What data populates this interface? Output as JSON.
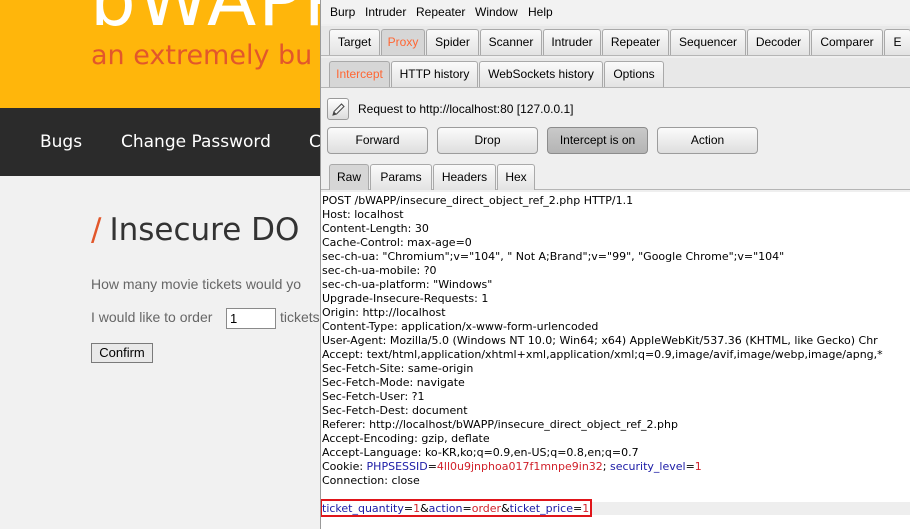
{
  "bwapp": {
    "logo": "bWAPP",
    "tagline": "an extremely bu",
    "nav": [
      "Bugs",
      "Change Password",
      "C"
    ],
    "title": "Insecure DO",
    "question": "How many movie tickets would yo",
    "order_label": "I would like to order",
    "quantity": "1",
    "tickets_label": "tickets",
    "confirm": "Confirm"
  },
  "burp": {
    "menu": [
      "Burp",
      "Intruder",
      "Repeater",
      "Window",
      "Help"
    ],
    "tabs": [
      "Target",
      "Proxy",
      "Spider",
      "Scanner",
      "Intruder",
      "Repeater",
      "Sequencer",
      "Decoder",
      "Comparer",
      "E"
    ],
    "subtabs": [
      "Intercept",
      "HTTP history",
      "WebSockets history",
      "Options"
    ],
    "request_to": "Request to http://localhost:80  [127.0.0.1]",
    "buttons": {
      "forward": "Forward",
      "drop": "Drop",
      "intercept": "Intercept is on",
      "action": "Action"
    },
    "viewtabs": [
      "Raw",
      "Params",
      "Headers",
      "Hex"
    ],
    "request_lines": [
      "POST /bWAPP/insecure_direct_object_ref_2.php HTTP/1.1",
      "Host: localhost",
      "Content-Length: 30",
      "Cache-Control: max-age=0",
      "sec-ch-ua: \"Chromium\";v=\"104\", \" Not A;Brand\";v=\"99\", \"Google Chrome\";v=\"104\"",
      "sec-ch-ua-mobile: ?0",
      "sec-ch-ua-platform: \"Windows\"",
      "Upgrade-Insecure-Requests: 1",
      "Origin: http://localhost",
      "Content-Type: application/x-www-form-urlencoded",
      "User-Agent: Mozilla/5.0 (Windows NT 10.0; Win64; x64) AppleWebKit/537.36 (KHTML, like Gecko) Chr",
      "Accept: text/html,application/xhtml+xml,application/xml;q=0.9,image/avif,image/webp,image/apng,*",
      "Sec-Fetch-Site: same-origin",
      "Sec-Fetch-Mode: navigate",
      "Sec-Fetch-User: ?1",
      "Sec-Fetch-Dest: document",
      "Referer: http://localhost/bWAPP/insecure_direct_object_ref_2.php",
      "Accept-Encoding: gzip, deflate",
      "Accept-Language: ko-KR,ko;q=0.9,en-US;q=0.8,en;q=0.7"
    ],
    "cookie": {
      "label": "Cookie: ",
      "name1": "PHPSESSID",
      "eq": "=",
      "value1": "4ll0u9jnphoa017f1mnpe9in32",
      "sep": "; ",
      "name2": "security_level",
      "value2": "1"
    },
    "connection": "Connection: close",
    "body": {
      "p1": "ticket_quantity",
      "v1": "1",
      "p2": "action",
      "v2": "order",
      "p3": "ticket_price",
      "v3": "1",
      "amp": "&",
      "eq": "="
    }
  },
  "colors": {
    "bwapp_orange": "#ffb60b",
    "burp_selected_tab": "#ff6633",
    "highlight_box": "#e0151a"
  }
}
